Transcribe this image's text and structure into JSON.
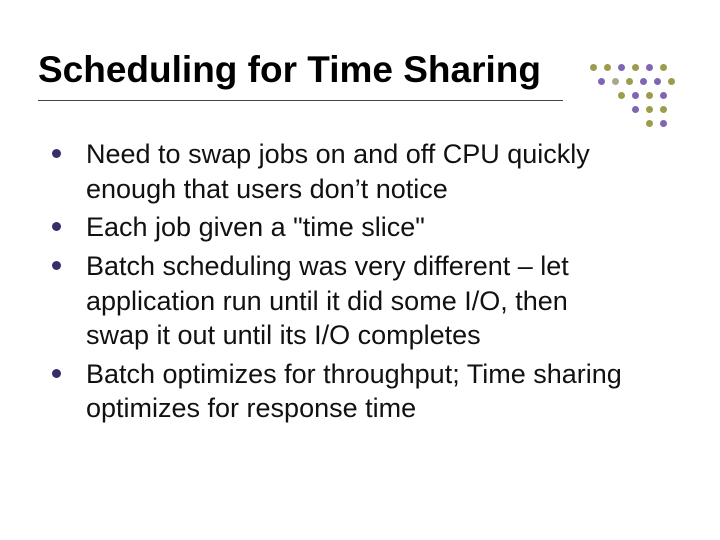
{
  "title": "Scheduling for Time Sharing",
  "bullets": [
    "Need to swap jobs on and off CPU quickly enough that users don’t notice",
    "Each job given a \"time slice\"",
    "Batch scheduling was very different – let application run until it did some I/O, then swap it out until its I/O completes",
    "Batch optimizes for throughput; Time sharing optimizes for response time"
  ],
  "dot_colors": {
    "olive": "#8b8b2d",
    "purple": "#6a4aa8",
    "gray": "#9a9a7a"
  }
}
